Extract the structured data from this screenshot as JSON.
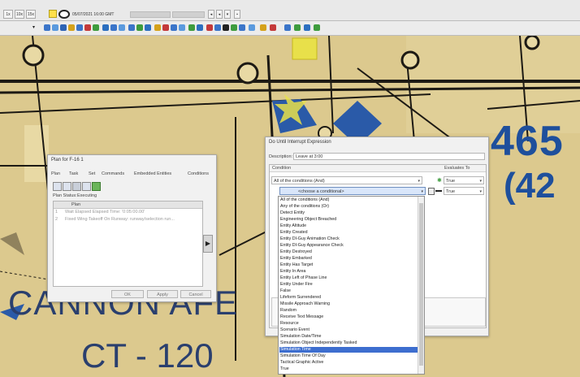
{
  "toolbar": {
    "speed_buttons": [
      "1x",
      "10x",
      "15x"
    ],
    "time": "05/07/2021 16:00 GMT"
  },
  "map": {
    "labels": [
      "465",
      "(42",
      "CANNON AFE",
      "CT - 120"
    ]
  },
  "plan_window": {
    "title": "Plan for F-16 1",
    "menu": [
      "Plan",
      "Task",
      "Set",
      "Commands",
      "Embedded Entities",
      "Conditions"
    ],
    "status_label": "Plan Status:",
    "status_value": "Executing",
    "table_header": "Plan",
    "rows": [
      {
        "num": "1",
        "text": "Wait Elapsed Elapsed Time: '0:05:00.00'"
      },
      {
        "num": "2",
        "text": "Fixed Wing Takeoff On Runway: runway/selection run..."
      }
    ],
    "buttons": [
      "OK",
      "Apply",
      "Cancel"
    ]
  },
  "interrupt_window": {
    "title": "Do Until Interrupt Expression",
    "description_label": "Description:",
    "description_value": "Leave at 3:00",
    "condition_header": "Condition",
    "evaluates_header": "Evaluates To",
    "condition_select": "All of the conditions (And)",
    "conditional_select": "<choose a conditional>",
    "evaluate_values": [
      "True",
      "True"
    ]
  },
  "dropdown": {
    "items": [
      "All of the conditions (And)",
      "Any of the conditions (Or)",
      "Detect Entity",
      "Engineering Object Breached",
      "Entity Altitude",
      "Entity Created",
      "Entity DI-Guy Animation Check",
      "Entity DI-Guy Appearance Check",
      "Entity Destroyed",
      "Entity Embarked",
      "Entity Has Target",
      "Entity In Area",
      "Entity Left of Phase Line",
      "Entity Under Fire",
      "False",
      "Lifeform Surrendered",
      "Missile Approach Warning",
      "Random",
      "Receive Text Message",
      "Resource",
      "Scenario Event",
      "Simulation Date/Time",
      "Simulation Object Independently Tasked",
      "Simulation Time",
      "Simulation Time Of Day",
      "Tactical Graphic Active",
      "True"
    ],
    "selected_index": 23
  }
}
